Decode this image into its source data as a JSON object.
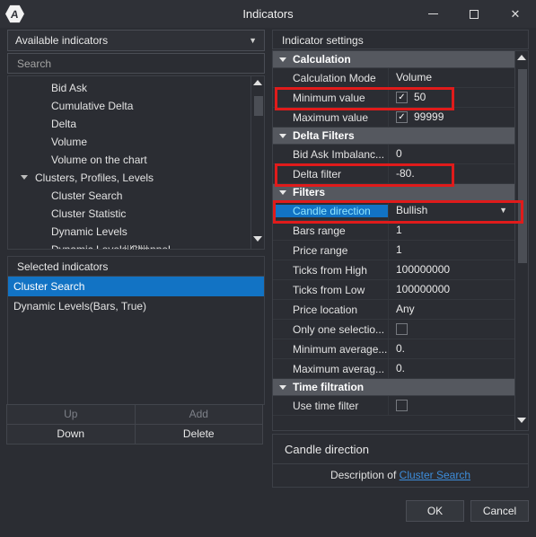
{
  "window": {
    "title": "Indicators",
    "logo_icon": "app-logo-icon",
    "minimize": "minimize-icon",
    "maximize": "maximize-icon",
    "close": "✕"
  },
  "left": {
    "available_label": "Available indicators",
    "caret": "▼",
    "search_placeholder": "Search",
    "search_value": "",
    "tree": [
      {
        "label": "Bid Ask",
        "type": "child"
      },
      {
        "label": "Cumulative Delta",
        "type": "child"
      },
      {
        "label": "Delta",
        "type": "child"
      },
      {
        "label": "Volume",
        "type": "child"
      },
      {
        "label": "Volume on the chart",
        "type": "child"
      },
      {
        "label": "Clusters, Profiles, Levels",
        "type": "group"
      },
      {
        "label": "Cluster Search",
        "type": "child"
      },
      {
        "label": "Cluster Statistic",
        "type": "child"
      },
      {
        "label": "Dynamic Levels",
        "type": "child"
      },
      {
        "label": "Dynamic Levels Channel",
        "type": "child"
      }
    ],
    "selected_header": "Selected indicators",
    "selected": [
      {
        "label": "Cluster Search",
        "active": true
      },
      {
        "label": "Dynamic Levels(Bars, True)",
        "active": false
      }
    ],
    "buttons": {
      "up": "Up",
      "add": "Add",
      "down": "Down",
      "delete": "Delete"
    }
  },
  "right": {
    "header": "Indicator settings",
    "rows": [
      {
        "kind": "group",
        "label": "Calculation"
      },
      {
        "kind": "row",
        "label": "Calculation Mode",
        "value": "Volume"
      },
      {
        "kind": "row",
        "label": "Minimum value",
        "value": "50",
        "checkbox": true,
        "checked": true,
        "highlight": "minimum-value"
      },
      {
        "kind": "row",
        "label": "Maximum value",
        "value": "99999",
        "checkbox": true,
        "checked": true
      },
      {
        "kind": "group",
        "label": "Delta Filters"
      },
      {
        "kind": "row",
        "label": "Bid Ask Imbalanc...",
        "value": "0"
      },
      {
        "kind": "row",
        "label": "Delta filter",
        "value": "-80.",
        "highlight": "delta-filter"
      },
      {
        "kind": "group",
        "label": "Filters"
      },
      {
        "kind": "row",
        "label": "Candle direction",
        "value": "Bullish",
        "selected": true,
        "dropdown": true,
        "highlight": "candle-direction"
      },
      {
        "kind": "row",
        "label": "Bars range",
        "value": "1"
      },
      {
        "kind": "row",
        "label": "Price range",
        "value": "1"
      },
      {
        "kind": "row",
        "label": "Ticks from High",
        "value": "100000000"
      },
      {
        "kind": "row",
        "label": "Ticks  from Low",
        "value": "100000000"
      },
      {
        "kind": "row",
        "label": "Price location",
        "value": "Any"
      },
      {
        "kind": "row",
        "label": "Only one selectio...",
        "value": "",
        "checkbox": true,
        "checked": false
      },
      {
        "kind": "row",
        "label": "Minimum average...",
        "value": "0."
      },
      {
        "kind": "row",
        "label": "Maximum averag...",
        "value": "0."
      },
      {
        "kind": "group",
        "label": "Time filtration"
      },
      {
        "kind": "row",
        "label": "Use time filter",
        "value": "",
        "checkbox": true,
        "checked": false
      }
    ],
    "description_title": "Candle direction",
    "description_prefix": "Description of ",
    "description_link": "Cluster Search",
    "checkmark": "✓",
    "caret": "▼"
  },
  "dialog": {
    "ok": "OK",
    "cancel": "Cancel"
  },
  "colors": {
    "highlight_red": "#e01b1b",
    "selection_blue": "#1273c4",
    "link_blue": "#3d8ddb",
    "window_bg": "#2b2d33"
  }
}
